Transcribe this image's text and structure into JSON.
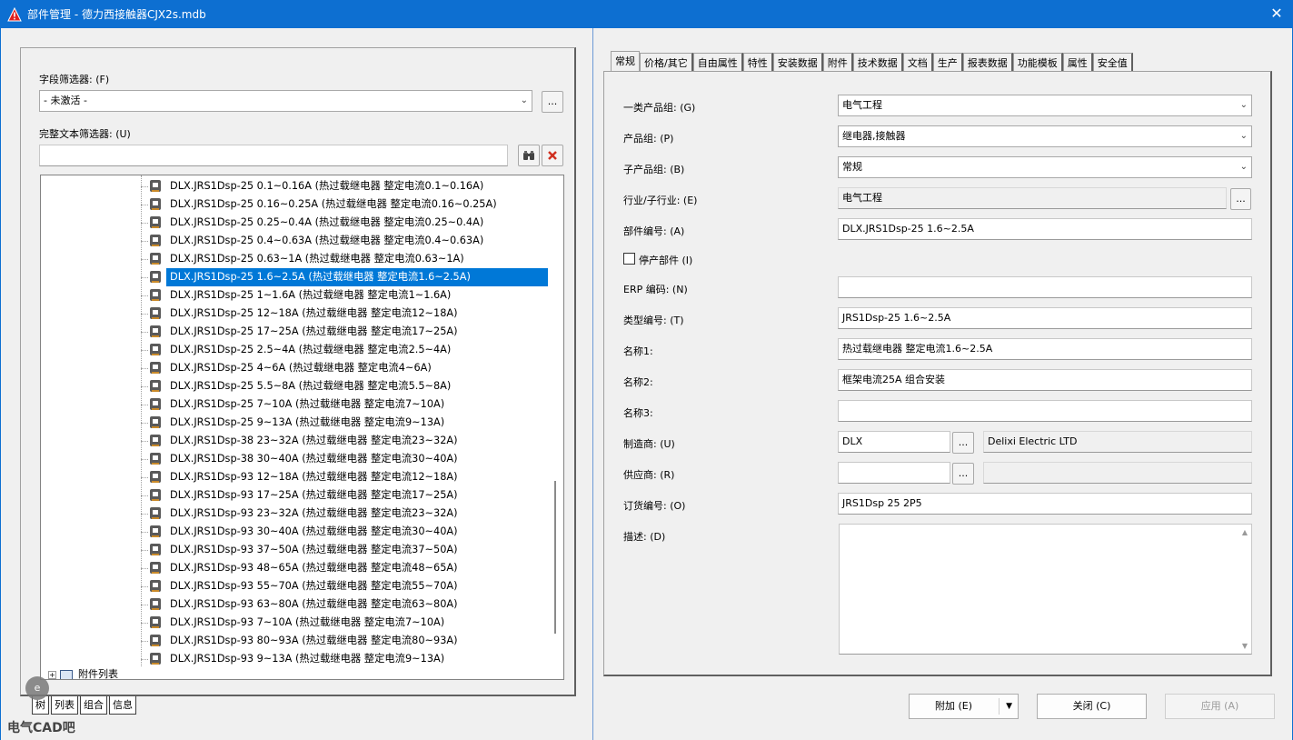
{
  "window": {
    "title": "部件管理 - 德力西接触器CJX2s.mdb",
    "close_glyph": "✕"
  },
  "left": {
    "field_filter_label": "字段筛选器: (F)",
    "field_filter_value": "- 未激活 -",
    "field_filter_button": "...",
    "text_filter_label": "完整文本筛选器: (U)",
    "text_filter_value": "",
    "search_icon": "binoculars-icon",
    "clear_icon": "red-x-icon",
    "tree_items": [
      "DLX.JRS1Dsp-25  0.1~0.16A (热过载继电器 整定电流0.1~0.16A)",
      "DLX.JRS1Dsp-25  0.16~0.25A (热过载继电器 整定电流0.16~0.25A)",
      "DLX.JRS1Dsp-25  0.25~0.4A (热过载继电器 整定电流0.25~0.4A)",
      "DLX.JRS1Dsp-25  0.4~0.63A (热过载继电器 整定电流0.4~0.63A)",
      "DLX.JRS1Dsp-25  0.63~1A (热过载继电器 整定电流0.63~1A)",
      "DLX.JRS1Dsp-25  1.6~2.5A (热过载继电器 整定电流1.6~2.5A)",
      "DLX.JRS1Dsp-25  1~1.6A (热过载继电器 整定电流1~1.6A)",
      "DLX.JRS1Dsp-25  12~18A (热过载继电器 整定电流12~18A)",
      "DLX.JRS1Dsp-25  17~25A (热过载继电器 整定电流17~25A)",
      "DLX.JRS1Dsp-25  2.5~4A (热过载继电器 整定电流2.5~4A)",
      "DLX.JRS1Dsp-25  4~6A (热过载继电器 整定电流4~6A)",
      "DLX.JRS1Dsp-25  5.5~8A (热过载继电器 整定电流5.5~8A)",
      "DLX.JRS1Dsp-25  7~10A (热过载继电器 整定电流7~10A)",
      "DLX.JRS1Dsp-25  9~13A (热过载继电器 整定电流9~13A)",
      "DLX.JRS1Dsp-38  23~32A (热过载继电器 整定电流23~32A)",
      "DLX.JRS1Dsp-38  30~40A (热过载继电器 整定电流30~40A)",
      "DLX.JRS1Dsp-93  12~18A (热过载继电器 整定电流12~18A)",
      "DLX.JRS1Dsp-93  17~25A (热过载继电器 整定电流17~25A)",
      "DLX.JRS1Dsp-93  23~32A (热过载继电器 整定电流23~32A)",
      "DLX.JRS1Dsp-93  30~40A (热过载继电器 整定电流30~40A)",
      "DLX.JRS1Dsp-93  37~50A (热过载继电器 整定电流37~50A)",
      "DLX.JRS1Dsp-93  48~65A (热过载继电器 整定电流48~65A)",
      "DLX.JRS1Dsp-93  55~70A (热过载继电器 整定电流55~70A)",
      "DLX.JRS1Dsp-93  63~80A (热过载继电器 整定电流63~80A)",
      "DLX.JRS1Dsp-93  7~10A (热过载继电器 整定电流7~10A)",
      "DLX.JRS1Dsp-93  80~93A (热过载继电器 整定电流80~93A)",
      "DLX.JRS1Dsp-93  9~13A (热过载继电器 整定电流9~13A)"
    ],
    "selected_index": 5,
    "bottom_node": "附件列表",
    "bottom_tabs": [
      "树",
      "列表",
      "组合",
      "信息"
    ],
    "watermark": "电气CAD吧"
  },
  "tabs": [
    "常规",
    "价格/其它",
    "自由属性",
    "特性",
    "安装数据",
    "附件",
    "技术数据",
    "文档",
    "生产",
    "报表数据",
    "功能模板",
    "属性",
    "安全值"
  ],
  "active_tab": 0,
  "form": {
    "product_group_1_label": "一类产品组: (G)",
    "product_group_1": "电气工程",
    "product_group_label": "产品组: (P)",
    "product_group": "继电器,接触器",
    "sub_product_group_label": "子产品组: (B)",
    "sub_product_group": "常规",
    "industry_label": "行业/子行业: (E)",
    "industry": "电气工程",
    "part_number_label": "部件编号: (A)",
    "part_number": "DLX.JRS1Dsp-25  1.6~2.5A",
    "discontinued_label": "停产部件 (I)",
    "erp_label": "ERP 编码: (N)",
    "erp": "",
    "type_number_label": "类型编号: (T)",
    "type_number": "JRS1Dsp-25  1.6~2.5A",
    "name1_label": "名称1:",
    "name1": "热过载继电器 整定电流1.6~2.5A",
    "name2_label": "名称2:",
    "name2": "框架电流25A 组合安装",
    "name3_label": "名称3:",
    "name3": "",
    "manufacturer_label": "制造商: (U)",
    "manufacturer": "DLX",
    "manufacturer_name": "Delixi Electric LTD",
    "supplier_label": "供应商: (R)",
    "supplier": "",
    "supplier_name": "",
    "order_number_label": "订货编号: (O)",
    "order_number": "JRS1Dsp 25 2P5",
    "description_label": "描述: (D)",
    "description": "",
    "ellipsis": "..."
  },
  "footer": {
    "add": "附加 (E)",
    "close": "关闭 (C)",
    "apply": "应用 (A)"
  }
}
